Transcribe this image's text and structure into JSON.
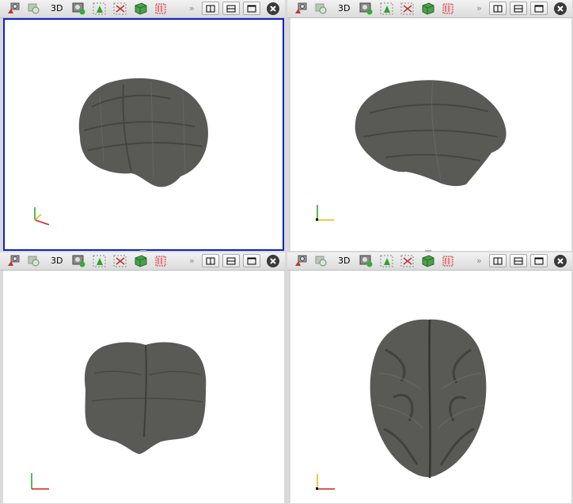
{
  "panes": [
    {
      "id": "pane-top-left",
      "toolbar": {
        "mode_label": "3D",
        "more_label": "»"
      },
      "view": "sagittal-left",
      "active": true
    },
    {
      "id": "pane-top-right",
      "toolbar": {
        "mode_label": "3D",
        "more_label": "»"
      },
      "view": "sagittal-right",
      "active": false
    },
    {
      "id": "pane-bottom-left",
      "toolbar": {
        "mode_label": "3D",
        "more_label": "»"
      },
      "view": "coronal",
      "active": false
    },
    {
      "id": "pane-bottom-right",
      "toolbar": {
        "mode_label": "3D",
        "more_label": "»"
      },
      "view": "axial",
      "active": false
    }
  ],
  "toolbar_icons": [
    "reset-camera-icon",
    "zoom-fit-icon",
    "snapshot-icon",
    "pick-icon",
    "select-box-icon",
    "green-cube-icon",
    "red-cube-icon"
  ],
  "layout_buttons": [
    "split-vertical-icon",
    "split-horizontal-icon",
    "maximize-icon",
    "close-icon"
  ],
  "colors": {
    "active_border": "#1020c8",
    "brain": "#595955",
    "axis_x": "#d02020",
    "axis_y": "#20a020",
    "axis_z": "#e0c000"
  }
}
